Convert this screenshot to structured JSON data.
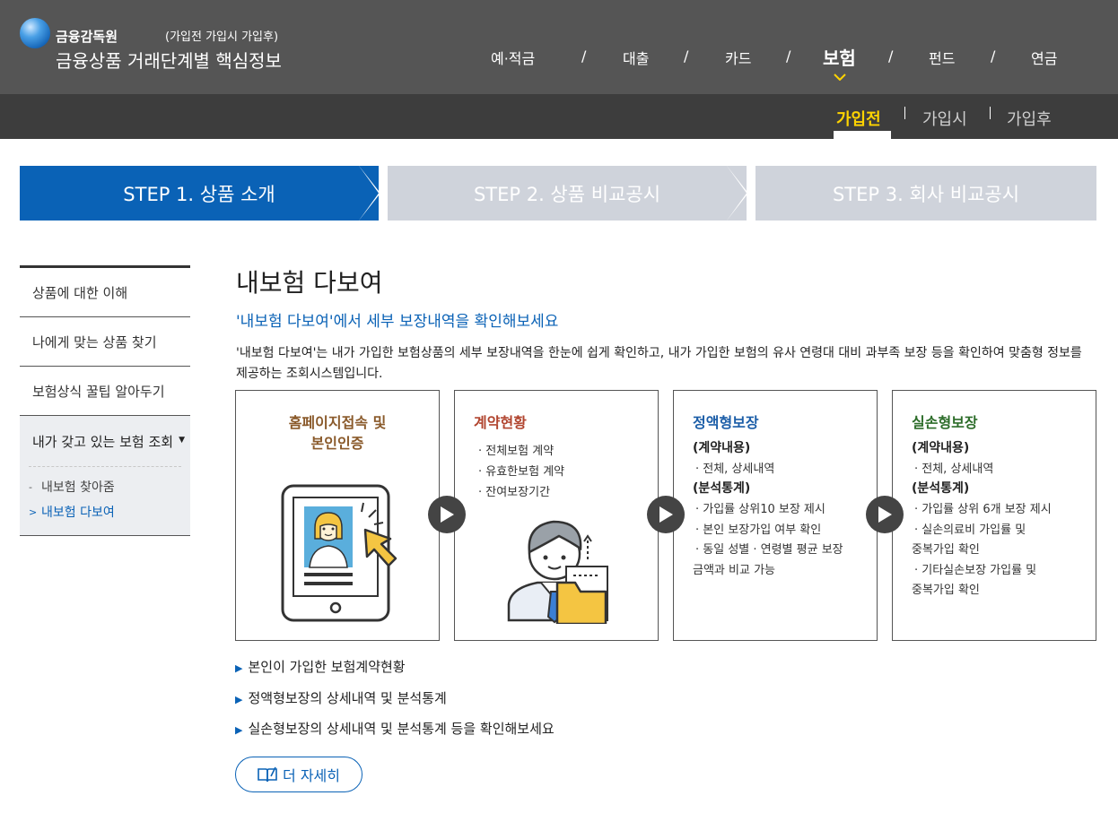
{
  "header": {
    "org_name": "금융감독원",
    "site_title": "금융상품 거래단계별 핵심정보",
    "sub_label": "(가입전  가입시  가입후)"
  },
  "gnb": {
    "items": [
      {
        "label": "예·적금",
        "active": false
      },
      {
        "label": "대출",
        "active": false
      },
      {
        "label": "카드",
        "active": false
      },
      {
        "label": "보험",
        "active": true
      },
      {
        "label": "펀드",
        "active": false
      },
      {
        "label": "연금",
        "active": false
      }
    ],
    "separator": "/"
  },
  "subnav": {
    "items": [
      {
        "label": "가입전",
        "active": true
      },
      {
        "label": "가입시",
        "active": false
      },
      {
        "label": "가입후",
        "active": false
      }
    ]
  },
  "steps": [
    {
      "label": "STEP 1. 상품 소개",
      "active": true
    },
    {
      "label": "STEP 2. 상품 비교공시",
      "active": false
    },
    {
      "label": "STEP 3. 회사 비교공시",
      "active": false
    }
  ],
  "lnb": {
    "items": [
      "상품에 대한 이해",
      "나에게 맞는 상품 찾기",
      "보험상식 꿀팁 알아두기"
    ],
    "group": {
      "label": "내가 갖고 있는 보험 조회",
      "sub_items": [
        {
          "label": "내보험 찾아줌",
          "marker": "-",
          "active": false
        },
        {
          "label": "내보험 다보여",
          "marker": ">",
          "active": true
        }
      ]
    }
  },
  "main": {
    "title": "내보험 다보여",
    "subtitle": "'내보험 다보여'에서 세부 보장내역을 확인해보세요",
    "description": "'내보험 다보여'는 내가 가입한 보험상품의 세부 보장내역을 한눈에 쉽게 확인하고, 내가 가입한 보험의 유사 연령대 대비 과부족 보장 등을 확인하여 맞춤형 정보를 제공하는 조회시스템입니다."
  },
  "cards": {
    "card1": {
      "title_line1": "홈페이지접속 및",
      "title_line2": "본인인증"
    },
    "card2": {
      "title": "계약현황",
      "lines": [
        "· 전체보험 계약",
        "· 유효한보험 계약",
        "· 잔여보장기간"
      ]
    },
    "card3": {
      "title": "정액형보장",
      "head1": "(계약내용)",
      "lines1": [
        "· 전체, 상세내역"
      ],
      "head2": "(분석통계)",
      "lines2": [
        "· 가입률 상위10 보장 제시",
        "· 본인 보장가입 여부 확인",
        "· 동일 성별 · 연령별 평균 보장",
        "금액과 비교 가능"
      ]
    },
    "card4": {
      "title": "실손형보장",
      "head1": "(계약내용)",
      "lines1": [
        "· 전체, 상세내역"
      ],
      "head2": "(분석통계)",
      "lines2": [
        "· 가입률 상위 6개 보장 제시",
        "· 실손의료비 가입률 및",
        "중복가입 확인",
        "· 기타실손보장 가입률 및",
        "중복가입 확인"
      ]
    }
  },
  "bullets": [
    "본인이 가입한 보험계약현황",
    "정액형보장의 상세내역 및 분석통계",
    "실손형보장의 상세내역 및 분석통계 등을 확인해보세요"
  ],
  "more_button": {
    "label": "더 자세히",
    "icon": "book-icon"
  },
  "colors": {
    "brand_blue": "#0a62b6",
    "header_dark": "#555555",
    "subnav_dark": "#3d3d3d",
    "active_yellow": "#ffd400",
    "step_inactive": "#cfd3db"
  }
}
